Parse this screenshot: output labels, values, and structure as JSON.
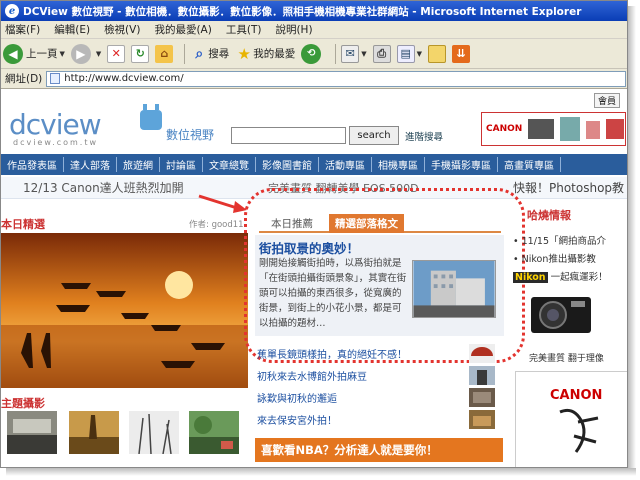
{
  "window": {
    "title": "DCView 數位視野 - 數位相機．數位攝影．數位影像．照相手機相機專業社群網站 - Microsoft Internet Explorer"
  },
  "menu": [
    "檔案(F)",
    "編輯(E)",
    "檢視(V)",
    "我的最愛(A)",
    "工具(T)",
    "說明(H)"
  ],
  "toolbar": {
    "back_label": "上一頁",
    "search_label": "搜尋",
    "favorites_label": "我的最愛"
  },
  "address": {
    "label": "網址(D)",
    "url": "http://www.dcview.com/"
  },
  "site": {
    "member_label": "會員",
    "logo_text": "dcview",
    "logo_sub": "dcview.com.tw",
    "name": "數位視野",
    "search_button": "search",
    "advanced_search": "進階搜尋",
    "banner_brand": "CANON"
  },
  "nav": [
    "作品發表區",
    "達人部落",
    "旅遊網",
    "討論區",
    "文章總覽",
    "影像圖書館",
    "活動專區",
    "相機專區",
    "手機攝影專區",
    "高畫質專區"
  ],
  "ticker": {
    "left": "12/13 Canon達人班熱烈加開",
    "middle": "完美畫質 翻轉美學 EOS 500D",
    "right": "快報！Photoshop教"
  },
  "left": {
    "section_title": "本日精選",
    "author": "作者: good11",
    "theme_title": "主題攝影"
  },
  "feature": {
    "tab_today": "本日推薦",
    "tab_blog": "精選部落格文",
    "title": "街拍取景的奧妙！",
    "body": "剛開始接觸街拍時，以爲街拍就是「在街頭拍攝街頭景象」，其實在街頭可以拍攝的東西很多，從寬廣的街景，到街上的小花小景，都是可以拍攝的題材…"
  },
  "list": [
    "蕉單長鏡頭樣拍，真的絕妊不感！",
    "初秋來去水博館外拍麻豆",
    "詠歎與初秋的邂逅",
    "來去保安宮外拍！"
  ],
  "nba_banner": "喜歡看NBA？分析達人就是要你！",
  "right": {
    "title": "哈燒情報",
    "item1": "11/15「網拍商品介",
    "item2": "Nikon推出攝影教",
    "nikon_brand": "Nikon",
    "item3": "一起瘋運彩！",
    "camera_caption": "完美畫質 翻于理像",
    "canon_ad": "CANON"
  },
  "colors": {
    "nav_bg": "#2a5d9c",
    "accent_red": "#e3342f",
    "tab_orange": "#e07830",
    "link_blue": "#1c4fa0"
  }
}
